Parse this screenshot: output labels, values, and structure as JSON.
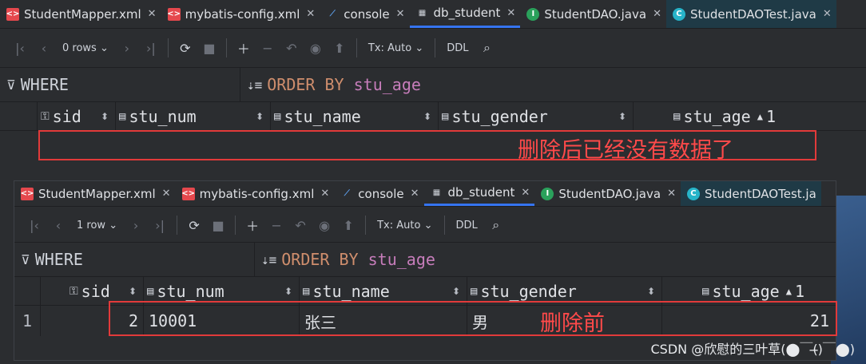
{
  "tabs": [
    {
      "label": "StudentMapper.xml",
      "icon": "xml-file-icon"
    },
    {
      "label": "mybatis-config.xml",
      "icon": "xml-file-icon"
    },
    {
      "label": "console",
      "icon": "console-icon"
    },
    {
      "label": "db_student",
      "icon": "table-icon"
    },
    {
      "label": "StudentDAO.java",
      "icon": "java-class-icon"
    },
    {
      "label": "StudentDAOTest.java",
      "icon": "test-class-icon"
    }
  ],
  "tabs_bottom_last": "StudentDAOTest.ja",
  "panel_after": {
    "rows_label": "0 rows",
    "tx_label": "Tx: Auto",
    "ddl_label": "DDL",
    "where_label": "WHERE",
    "order_kw": "ORDER BY",
    "order_col": "stu_age",
    "columns": [
      "sid",
      "stu_num",
      "stu_name",
      "stu_gender",
      "stu_age"
    ],
    "sort_badge": "1",
    "note": "删除后已经没有数据了"
  },
  "panel_before": {
    "rows_label": "1 row",
    "tx_label": "Tx: Auto",
    "ddl_label": "DDL",
    "where_label": "WHERE",
    "order_kw": "ORDER BY",
    "order_col": "stu_age",
    "columns": [
      "sid",
      "stu_num",
      "stu_name",
      "stu_gender",
      "stu_age"
    ],
    "sort_badge": "1",
    "row": {
      "index": "1",
      "sid": "2",
      "stu_num": "10001",
      "stu_name": "张三",
      "stu_gender": "男",
      "stu_age": "21"
    },
    "note": "删除前"
  },
  "watermark": "CSDN @欣慰的三叶草(⬤￣(̶)￣⬤)",
  "colors": {
    "accent": "#3574f0",
    "annotation": "#e23a3a",
    "keyword": "#cf8e6d",
    "column": "#c77dbb"
  }
}
